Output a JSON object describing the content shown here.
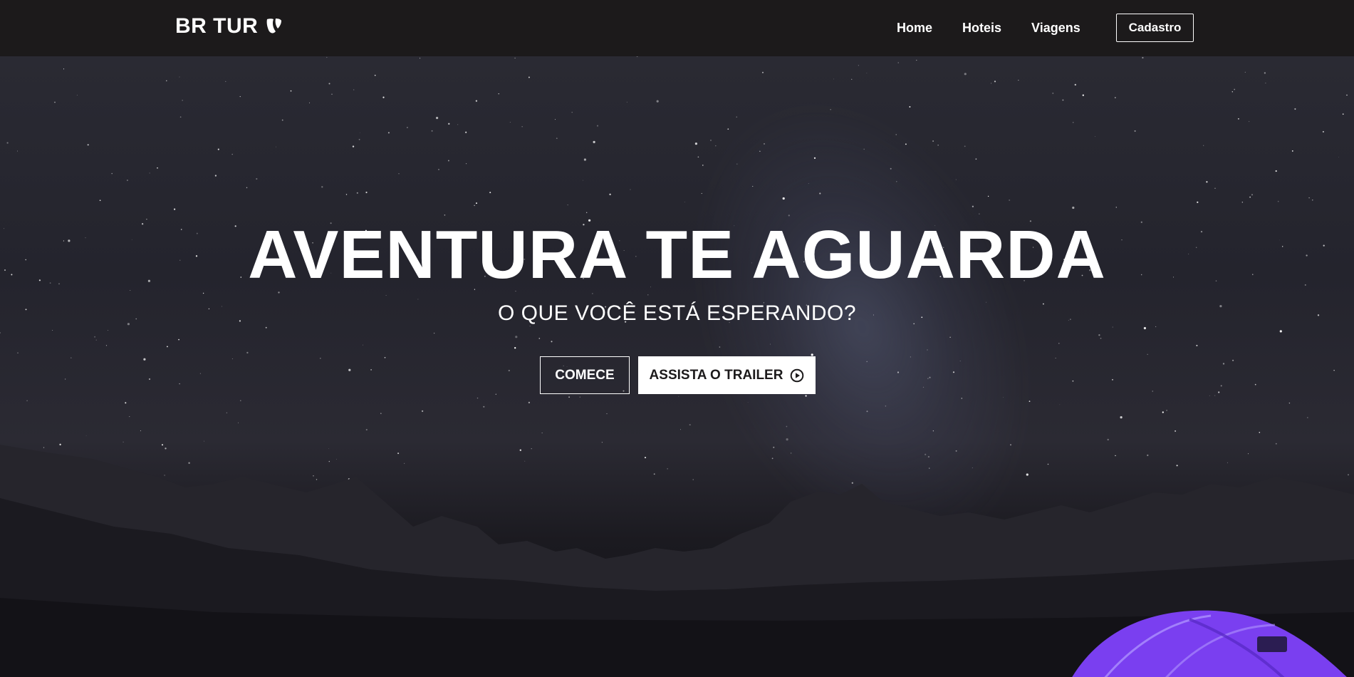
{
  "navbar": {
    "brand": "BR TUR",
    "brand_icon": "typo3-logo-icon",
    "links": [
      "Home",
      "Hoteis",
      "Viagens"
    ],
    "signup_label": "Cadastro"
  },
  "hero": {
    "headline": "AVENTURA TE AGUARDA",
    "subheadline": "O QUE VOCÊ ESTÁ ESPERANDO?",
    "primary_cta": "COMECE",
    "secondary_cta": "ASSISTA O TRAILER",
    "secondary_cta_icon": "play-circle-icon",
    "background": "night-sky-mountains-tent"
  },
  "colors": {
    "navbar_bg": "#1c1a1b",
    "tent": "#7a3ff0",
    "text": "#ffffff"
  }
}
